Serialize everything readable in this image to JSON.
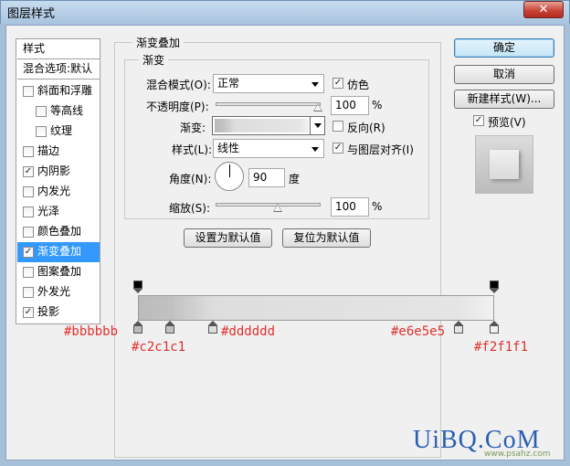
{
  "window": {
    "title": "图层样式",
    "close_glyph": "✕"
  },
  "style_list": {
    "header": "样式",
    "blend_options": "混合选项:默认",
    "items": [
      {
        "label": "斜面和浮雕",
        "checked": false
      },
      {
        "label": "等高线",
        "checked": false
      },
      {
        "label": "纹理",
        "checked": false
      },
      {
        "label": "描边",
        "checked": false
      },
      {
        "label": "内阴影",
        "checked": true
      },
      {
        "label": "内发光",
        "checked": false
      },
      {
        "label": "光泽",
        "checked": false
      },
      {
        "label": "颜色叠加",
        "checked": false
      },
      {
        "label": "渐变叠加",
        "checked": true
      },
      {
        "label": "图案叠加",
        "checked": false
      },
      {
        "label": "外发光",
        "checked": false
      },
      {
        "label": "投影",
        "checked": true
      }
    ]
  },
  "panel": {
    "section_title": "渐变叠加",
    "group_title": "渐变",
    "blend_mode_label": "混合模式(O):",
    "blend_mode_value": "正常",
    "dither_label": "仿色",
    "dither_checked": true,
    "opacity_label": "不透明度(P):",
    "opacity_value": "100",
    "opacity_unit": "%",
    "opacity_level": 1.0,
    "gradient_label": "渐变:",
    "reverse_label": "反向(R)",
    "reverse_checked": false,
    "style_label": "样式(L):",
    "style_value": "线性",
    "align_label": "与图层对齐(I)",
    "align_checked": true,
    "angle_label": "角度(N):",
    "angle_value": "90",
    "angle_unit": "度",
    "scale_label": "缩放(S):",
    "scale_value": "100",
    "scale_unit": "%",
    "scale_level": 0.5,
    "set_default_button": "设置为默认值",
    "reset_default_button": "复位为默认值"
  },
  "buttons": {
    "ok": "确定",
    "cancel": "取消",
    "new_style": "新建样式(W)...",
    "preview_label": "预览(V)",
    "preview_checked": true
  },
  "gradient_stops": [
    {
      "color": "#bbbbbb",
      "label": "#bbbbbb",
      "location": 0.0
    },
    {
      "color": "#c2c1c1",
      "label": "#c2c1c1",
      "location": 0.09
    },
    {
      "color": "#dddddd",
      "label": "#dddddd",
      "location": 0.21
    },
    {
      "color": "#e6e5e5",
      "label": "#e6e5e5",
      "location": 0.9
    },
    {
      "color": "#f2f1f1",
      "label": "#f2f1f1",
      "location": 1.0
    }
  ],
  "opacity_stops": [
    {
      "location": 0.0,
      "opacity": 100
    },
    {
      "location": 1.0,
      "opacity": 100
    }
  ],
  "watermark": {
    "main": "UiBQ.CoM",
    "sub": "www.psahz.com"
  }
}
